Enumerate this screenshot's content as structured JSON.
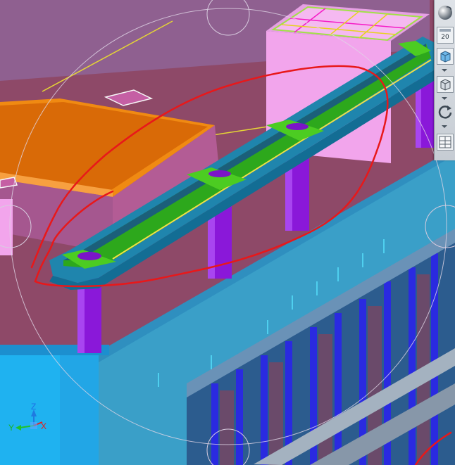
{
  "toolbar": {
    "zoom_value": "20",
    "buttons": [
      {
        "id": "sphere",
        "icon": "sphere-view-icon"
      },
      {
        "id": "zoom",
        "icon": "zoom-level-icon"
      },
      {
        "id": "cube",
        "icon": "cube-view-icon"
      },
      {
        "id": "box",
        "icon": "box-view-icon"
      },
      {
        "id": "rotate",
        "icon": "rotate-icon"
      },
      {
        "id": "layout",
        "icon": "layout-grid-icon"
      }
    ]
  },
  "axis_triad": {
    "z": "Z",
    "y": "Y",
    "x": "X"
  },
  "colors": {
    "background": "#8e4968",
    "wall": "#3a8fb7",
    "beam_green": "#3ea52a",
    "column_purple": "#8a18d9",
    "orange_slab": "#f07a0e",
    "pink_block": "#f2a5ec",
    "annotation_red": "#e8181a"
  }
}
